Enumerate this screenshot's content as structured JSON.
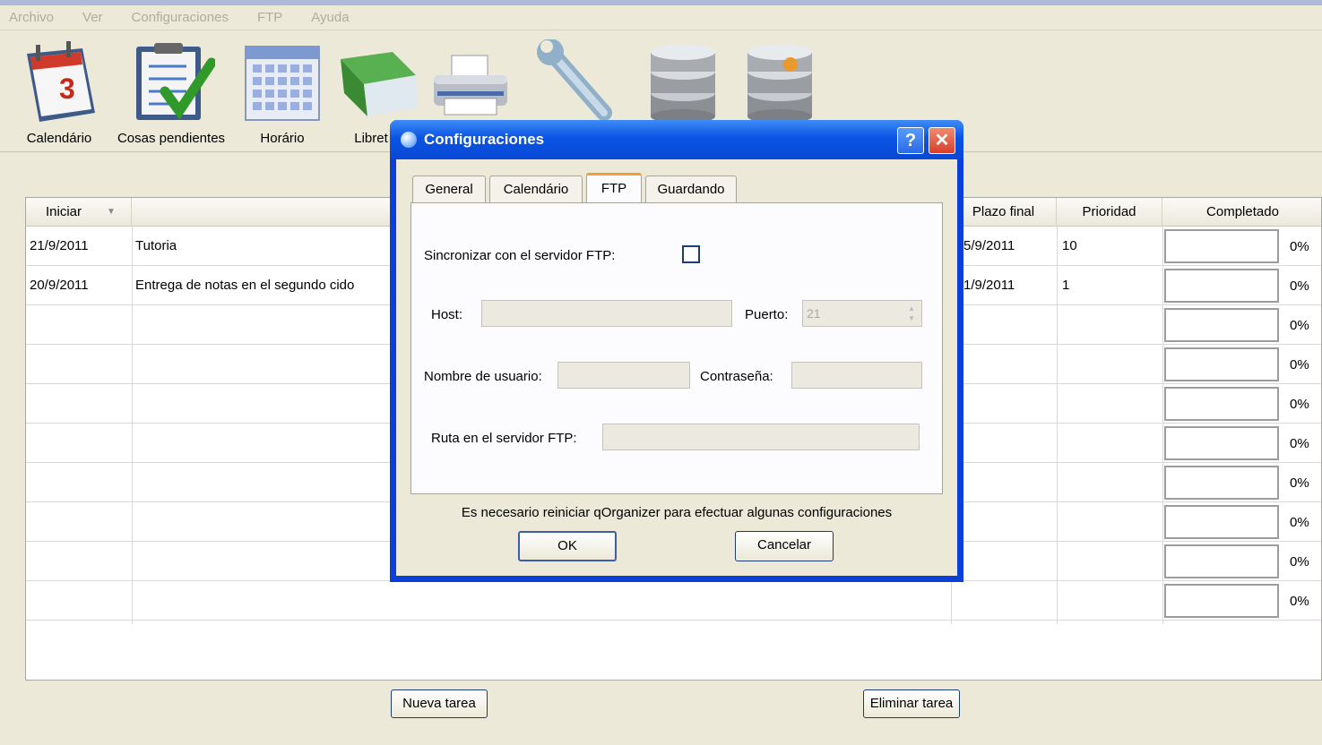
{
  "menu": [
    "Archivo",
    "Ver",
    "Configuraciones",
    "FTP",
    "Ayuda"
  ],
  "toolbar": [
    {
      "label": "Calendário",
      "icon": "calendar-icon"
    },
    {
      "label": "Cosas pendientes",
      "icon": "todo-checklist-icon"
    },
    {
      "label": "Horário",
      "icon": "schedule-grid-icon"
    },
    {
      "label": "Libret",
      "icon": "notebook-icon"
    },
    {
      "label": "",
      "icon": "printer-icon"
    },
    {
      "label": "",
      "icon": "wrench-icon"
    },
    {
      "label": "",
      "icon": "database-icon"
    },
    {
      "label": "",
      "icon": "database-sql-icon"
    }
  ],
  "table": {
    "headers": {
      "start": "Iniciar",
      "deadline": "Plazo final",
      "priority": "Prioridad",
      "completed": "Completado"
    },
    "rows": [
      {
        "start": "21/9/2011",
        "subject": "Tutoria",
        "deadline": "5/9/2011",
        "priority": "10",
        "percent": "0%"
      },
      {
        "start": "20/9/2011",
        "subject": "Entrega de notas en el segundo cido",
        "deadline": "1/9/2011",
        "priority": "1",
        "percent": "0%"
      },
      {
        "start": "",
        "subject": "",
        "deadline": "",
        "priority": "",
        "percent": "0%"
      },
      {
        "start": "",
        "subject": "",
        "deadline": "",
        "priority": "",
        "percent": "0%"
      },
      {
        "start": "",
        "subject": "",
        "deadline": "",
        "priority": "",
        "percent": "0%"
      },
      {
        "start": "",
        "subject": "",
        "deadline": "",
        "priority": "",
        "percent": "0%"
      },
      {
        "start": "",
        "subject": "",
        "deadline": "",
        "priority": "",
        "percent": "0%"
      },
      {
        "start": "",
        "subject": "",
        "deadline": "",
        "priority": "",
        "percent": "0%"
      },
      {
        "start": "",
        "subject": "",
        "deadline": "",
        "priority": "",
        "percent": "0%"
      },
      {
        "start": "",
        "subject": "",
        "deadline": "",
        "priority": "",
        "percent": "0%"
      }
    ]
  },
  "buttons": {
    "new_task": "Nueva tarea",
    "delete_task": "Eliminar tarea"
  },
  "dialog": {
    "title": "Configuraciones",
    "help": "?",
    "close": "✕",
    "tabs": [
      "General",
      "Calendário",
      "FTP",
      "Guardando"
    ],
    "active_tab": "FTP",
    "sync_label": "Sincronizar con el servidor FTP:",
    "sync_checked": false,
    "host_label": "Host:",
    "host_value": "",
    "port_label": "Puerto:",
    "port_value": "21",
    "user_label": "Nombre de usuario:",
    "user_value": "",
    "password_label": "Contraseña:",
    "password_value": "",
    "path_label": "Ruta en el servidor FTP:",
    "path_value": "",
    "note": "Es necesario reiniciar qOrganizer para efectuar algunas configuraciones",
    "ok": "OK",
    "cancel": "Cancelar"
  },
  "colors": {
    "titlebar": "#0a54e4",
    "close_button": "#e0452a",
    "window_bg": "#ece9d8"
  }
}
